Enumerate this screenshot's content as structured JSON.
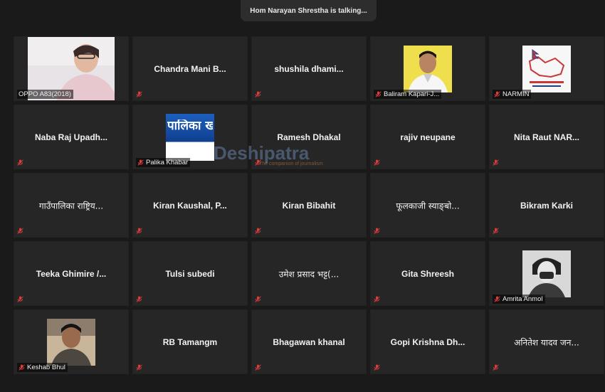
{
  "talking_banner": "Hom Narayan Shrestha is talking...",
  "watermark": {
    "text": "Deshipatra",
    "tagline": "The companion of journalism"
  },
  "participants": [
    {
      "name": "OPPO A83(2018)",
      "video": "person-photo",
      "muted": false
    },
    {
      "name": "Chandra  Mani  B...",
      "video": null,
      "muted": true
    },
    {
      "name": "shushila  dhami...",
      "video": null,
      "muted": true
    },
    {
      "name": "Baliram Kapari-J...",
      "video": "person-photo",
      "muted": true
    },
    {
      "name": "NARMIN",
      "video": "logo-photo",
      "muted": true
    },
    {
      "name": "Naba  Raj  Upadh...",
      "video": null,
      "muted": true
    },
    {
      "name": "Palika Khabar",
      "video": "logo-photo",
      "logo_text": "पालिका खबर",
      "muted": true
    },
    {
      "name": "Ramesh Dhakal",
      "video": null,
      "muted": true
    },
    {
      "name": "rajiv neupane",
      "video": null,
      "muted": true
    },
    {
      "name": "Nita  Raut  NAR...",
      "video": null,
      "muted": true
    },
    {
      "name": "गाउँपालिका राष्ट्रिय...",
      "video": null,
      "muted": true
    },
    {
      "name": "Kiran  Kaushal,  P...",
      "video": null,
      "muted": true
    },
    {
      "name": "Kiran Bibahit",
      "video": null,
      "muted": true
    },
    {
      "name": "फूलकाजी स्याङ्बो...",
      "video": null,
      "muted": true
    },
    {
      "name": "Bikram Karki",
      "video": null,
      "muted": true
    },
    {
      "name": "Teeka  Ghimire  /...",
      "video": null,
      "muted": true
    },
    {
      "name": "Tulsi subedi",
      "video": null,
      "muted": true
    },
    {
      "name": "उमेश प्रसाद भट्ट(...",
      "video": null,
      "muted": true
    },
    {
      "name": "Gita Shreesh",
      "video": null,
      "muted": true
    },
    {
      "name": "Amrita Anmol",
      "video": "person-photo",
      "muted": true
    },
    {
      "name": "Keshab Bhul",
      "video": "person-photo",
      "muted": true
    },
    {
      "name": "RB Tamangm",
      "video": null,
      "muted": true
    },
    {
      "name": "Bhagawan khanal",
      "video": null,
      "muted": true
    },
    {
      "name": "Gopi  Krishna  Dh...",
      "video": null,
      "muted": true
    },
    {
      "name": "अनितेश यादव जन...",
      "video": null,
      "muted": true
    }
  ],
  "colors": {
    "muted_icon": "#e23b3b",
    "tile_bg": "#262626",
    "page_bg": "#1a1a1a"
  }
}
